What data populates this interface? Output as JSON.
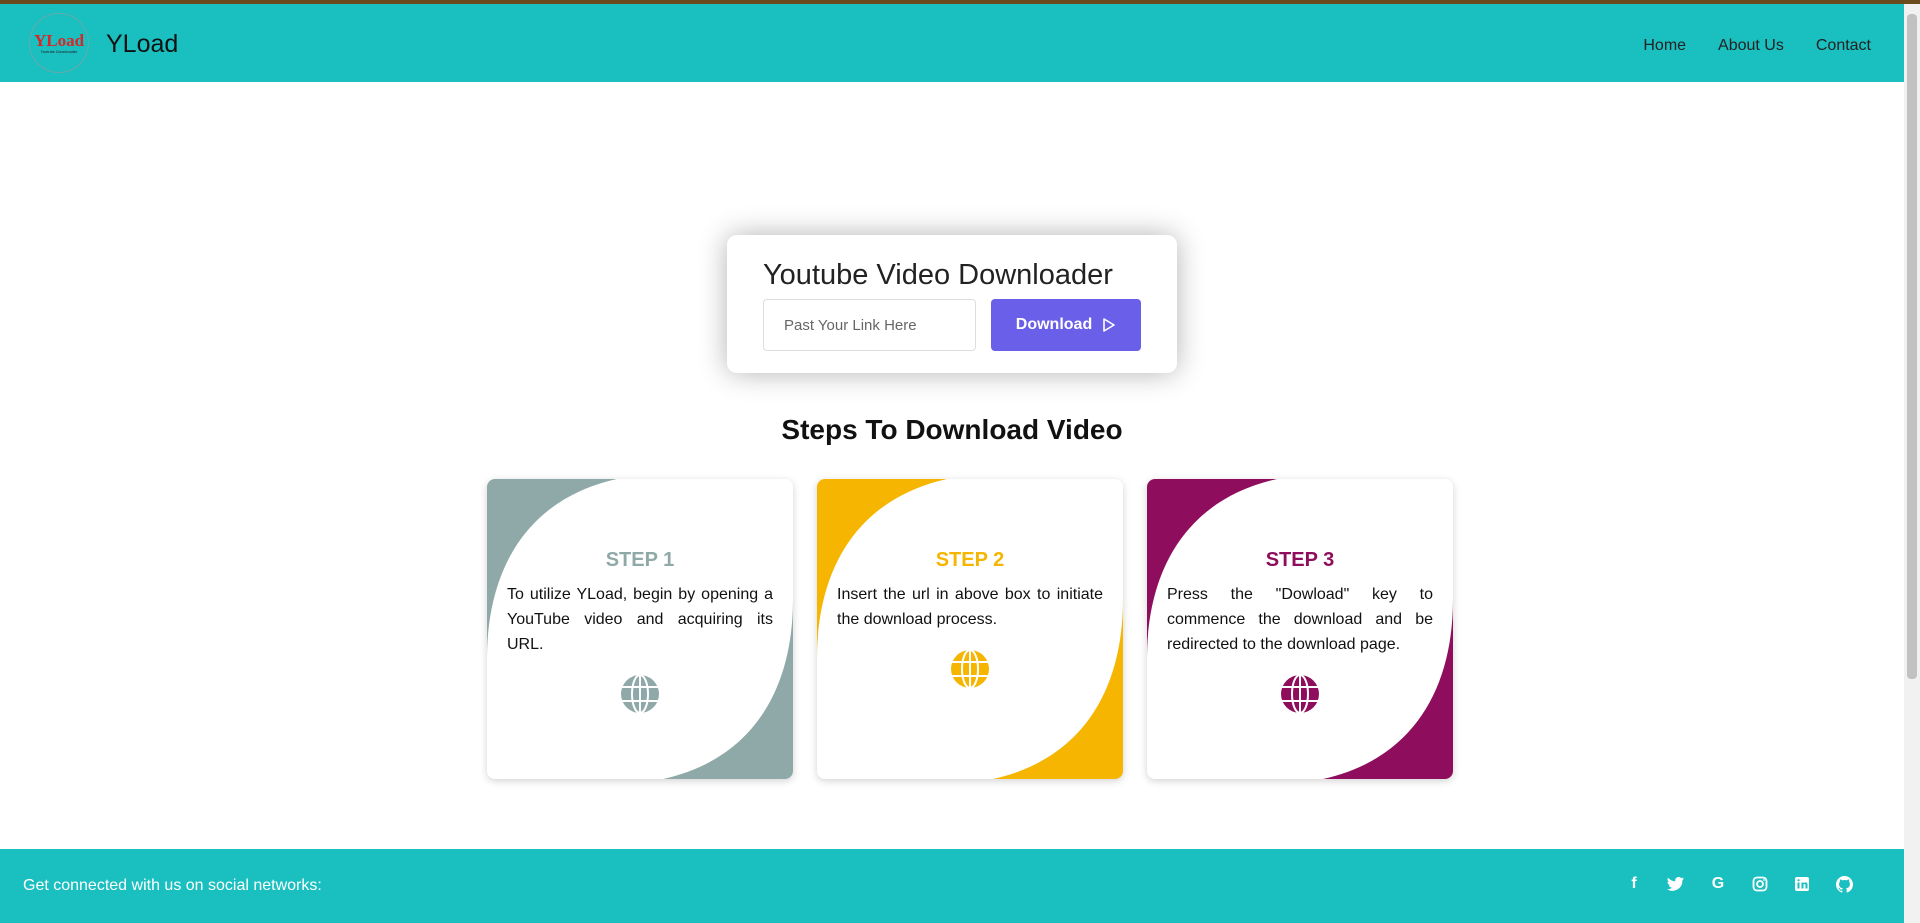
{
  "navbar": {
    "logo_text": "YLoad",
    "logo_subtext": "Youtube Downloader",
    "brand": "YLoad",
    "links": [
      "Home",
      "About Us",
      "Contact"
    ]
  },
  "downloader": {
    "title": "Youtube Video Downloader",
    "input_placeholder": "Past Your Link Here",
    "button_label": "Download"
  },
  "steps_title": "Steps To Download Video",
  "steps": [
    {
      "label": "STEP 1",
      "text": "To utilize YLoad, begin by opening a YouTube video and acquiring its URL.",
      "color": "#8FA9A8"
    },
    {
      "label": "STEP 2",
      "text": "Insert the url in above box to initiate the download process.",
      "color": "#F5B500"
    },
    {
      "label": "STEP 3",
      "text": "Press the \"Dowload\" key to commence the download and be redirected to the download page.",
      "color": "#8E0E5D"
    }
  ],
  "footer": {
    "text": "Get connected with us on social networks:",
    "socials": [
      "facebook-icon",
      "twitter-icon",
      "google-icon",
      "instagram-icon",
      "linkedin-icon",
      "github-icon"
    ]
  },
  "colors": {
    "accent": "#1ABFC0",
    "button": "#6A5FE8"
  }
}
